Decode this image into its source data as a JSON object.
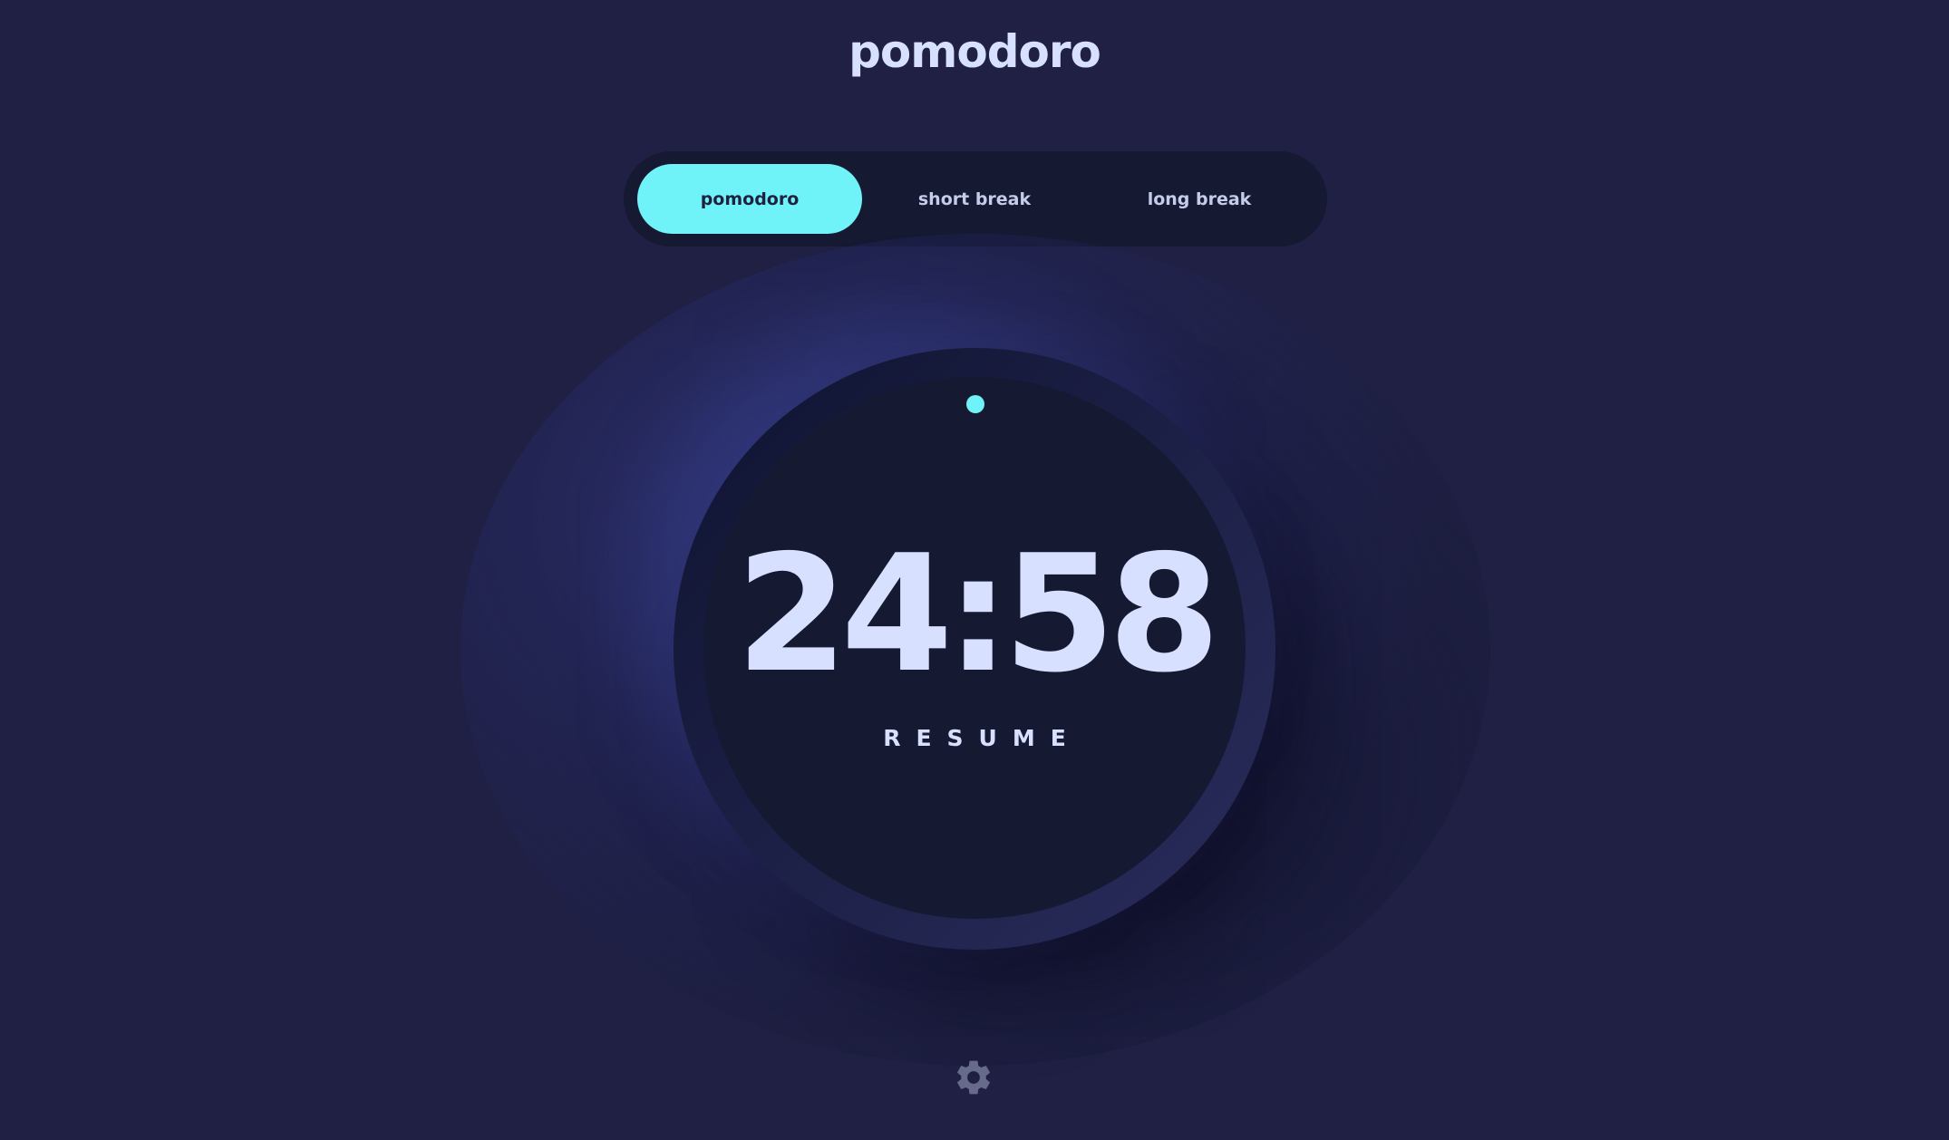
{
  "app": {
    "title": "pomodoro"
  },
  "modes": {
    "items": [
      {
        "label": "pomodoro",
        "active": true
      },
      {
        "label": "short break",
        "active": false
      },
      {
        "label": "long break",
        "active": false
      }
    ]
  },
  "timer": {
    "time": "24:58",
    "action_label": "RESUME",
    "progress_fraction": 0.9987
  },
  "settings": {
    "icon": "gear-icon"
  },
  "colors": {
    "background": "#1f2043",
    "panel": "#161932",
    "accent": "#70f3f8",
    "text": "#d7e0fe",
    "icon": "#666a8b"
  }
}
